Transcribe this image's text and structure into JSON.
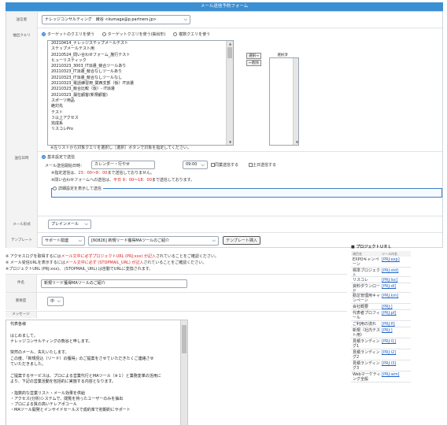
{
  "header": {
    "title": "メール送信予約フォーム"
  },
  "sender": {
    "label": "送信者",
    "value": "ナレッジコンサルティング　綾谷 <kumaga@p.partners.jp>"
  },
  "query": {
    "label": "抽出クエリ",
    "radio_options": [
      "ターゲットのクエリを使う",
      "ターゲットクエリを使う(抽出形)",
      "複数クエリを使う"
    ],
    "items": [
      "20210414_ナレッジステップメールテスト",
      "ステップメールテスト用",
      "20210524_問い合わせフォーム_施行テスト",
      "ヒューリスティック",
      "20210323_3003_IT派遣_競合ツールあり",
      "20210323_IT派遣_競合なしツールあり",
      "20210323_IT派遣_競合なしツールなし",
      "20210323_電話練習用_関西支部（仮）IT派遣",
      "20210323_競合比較（仮）- IT派遣",
      "20210323_漏在顧客(新規顧客)",
      "スポーツ用品",
      "絶対先",
      "テスト",
      "３以上アクセス",
      "完成系",
      "リスコレPro"
    ],
    "select_btn": "選択→",
    "remove_btn": "←削除",
    "selected_header": "選択済",
    "note": "※左リストから対象クエリを選択し［選択］ボタンで対象を指定してください。"
  },
  "schedule": {
    "label": "送信日時",
    "option1": "基本設定で送信",
    "date_label": "メール送信開始日時：",
    "date_value": "カレンダー・行やせ",
    "time_value": "09:00",
    "cb1": "同業送信する",
    "cb2": "土日送信する",
    "note1_pre": "※指定送信は、",
    "note1_red": "23：00～8：00",
    "note1_post": "まで送信しておりません。",
    "note2_pre": "※問い合わせフォームへの送信は、",
    "note2_red": "平日 9：00～18：00",
    "note2_post": "まで送信しております。",
    "option2": "詳細設定を表示して送信"
  },
  "mail_format": {
    "label": "メール形式",
    "value": "プレインメール"
  },
  "template": {
    "label": "テンプレート",
    "category_value": "サポート関連",
    "template_value": "[60826] 新規リード獲得MAツールのご紹介",
    "insert_btn": "テンプレート挿入"
  },
  "notices": {
    "line1_pre": "※ アクセスログを取得するには",
    "line1_red": "メール文中に必ずプロジェクトURL (PRJ:xxx) が記入",
    "line1_post": "されていることをご確認ください。",
    "line2_pre": "※ メール受信URLを表示するには",
    "line2_red": "メール文中に必ず (STOPMAIL_URL) が記入",
    "line2_post": "されていることをご確認ください。",
    "line3": "※プロジェクトURL (PRJ:xxx)、 (STOPMAIL_URL) は自動でURLに変換されます。"
  },
  "subject": {
    "label": "件名",
    "value": "新規リード獲得MAツールのご紹介"
  },
  "importance": {
    "label": "重要度",
    "value": "中"
  },
  "message": {
    "label": "メッセージ",
    "lines": [
      "代表各様",
      "",
      "はじめまして。",
      "ナレッジコンサルティングの熊谷と申します。",
      "",
      "突然のメール、失礼いたします。",
      "この度、「新規見込（リード）の獲得」のご提案をさせていただきたくご連絡させ",
      "ていただきました。",
      "",
      "ご提案するサービスは、プロによる営業代行とMAツール（※１）と業務変革の活用に",
      "より、下記の営業活動を包括的に実施する内容となります。",
      "",
      "・指数的な営業リスト・メール効果を供給",
      "・アクセス(分析)システムで、閲覧を持ったユーザーのみを抽出",
      "・プロによる質の高いテレアポコール",
      "・MAツール開発とインサイドセールスで成約率で初期的にサポート"
    ]
  },
  "project_panel": {
    "title": "■ プロジェクトＵＲＬ",
    "col_name": "項目名",
    "col_url": "ツール内名",
    "rows": [
      {
        "name": "EXPOキャンペーン",
        "code": "[PRJ:exp]"
      },
      {
        "name": "標準プロジェクト",
        "code": "[PRJ:std]"
      },
      {
        "name": "リスコレ",
        "code": "[PRJ:lsc]"
      },
      {
        "name": "資料ダウンロード",
        "code": "[PRJ:dl]"
      },
      {
        "name": "勤怠管理用キャンペーン",
        "code": "[PRJ:km]"
      },
      {
        "name": "会社概要",
        "code": "[PRJ:]"
      },
      {
        "name": "代表者プロフィール",
        "code": "[PRJ:pf]"
      },
      {
        "name": "ご利用の流れ",
        "code": "[PRJ:fl]"
      },
      {
        "name": "新規（社内テスト用）",
        "code": "[PRJ:]"
      },
      {
        "name": "見積ランディング1",
        "code": "[PRJ:l1]"
      },
      {
        "name": "見積ランディング2",
        "code": "[PRJ:l2]"
      },
      {
        "name": "見積ランディング3",
        "code": "[PRJ:l3]"
      },
      {
        "name": "Webマーケティング全般",
        "code": "[PRJ:wm]"
      }
    ]
  },
  "colors": {
    "accent": "#3b8fd3",
    "link": "#1b5fc9",
    "warn": "#e02020"
  }
}
